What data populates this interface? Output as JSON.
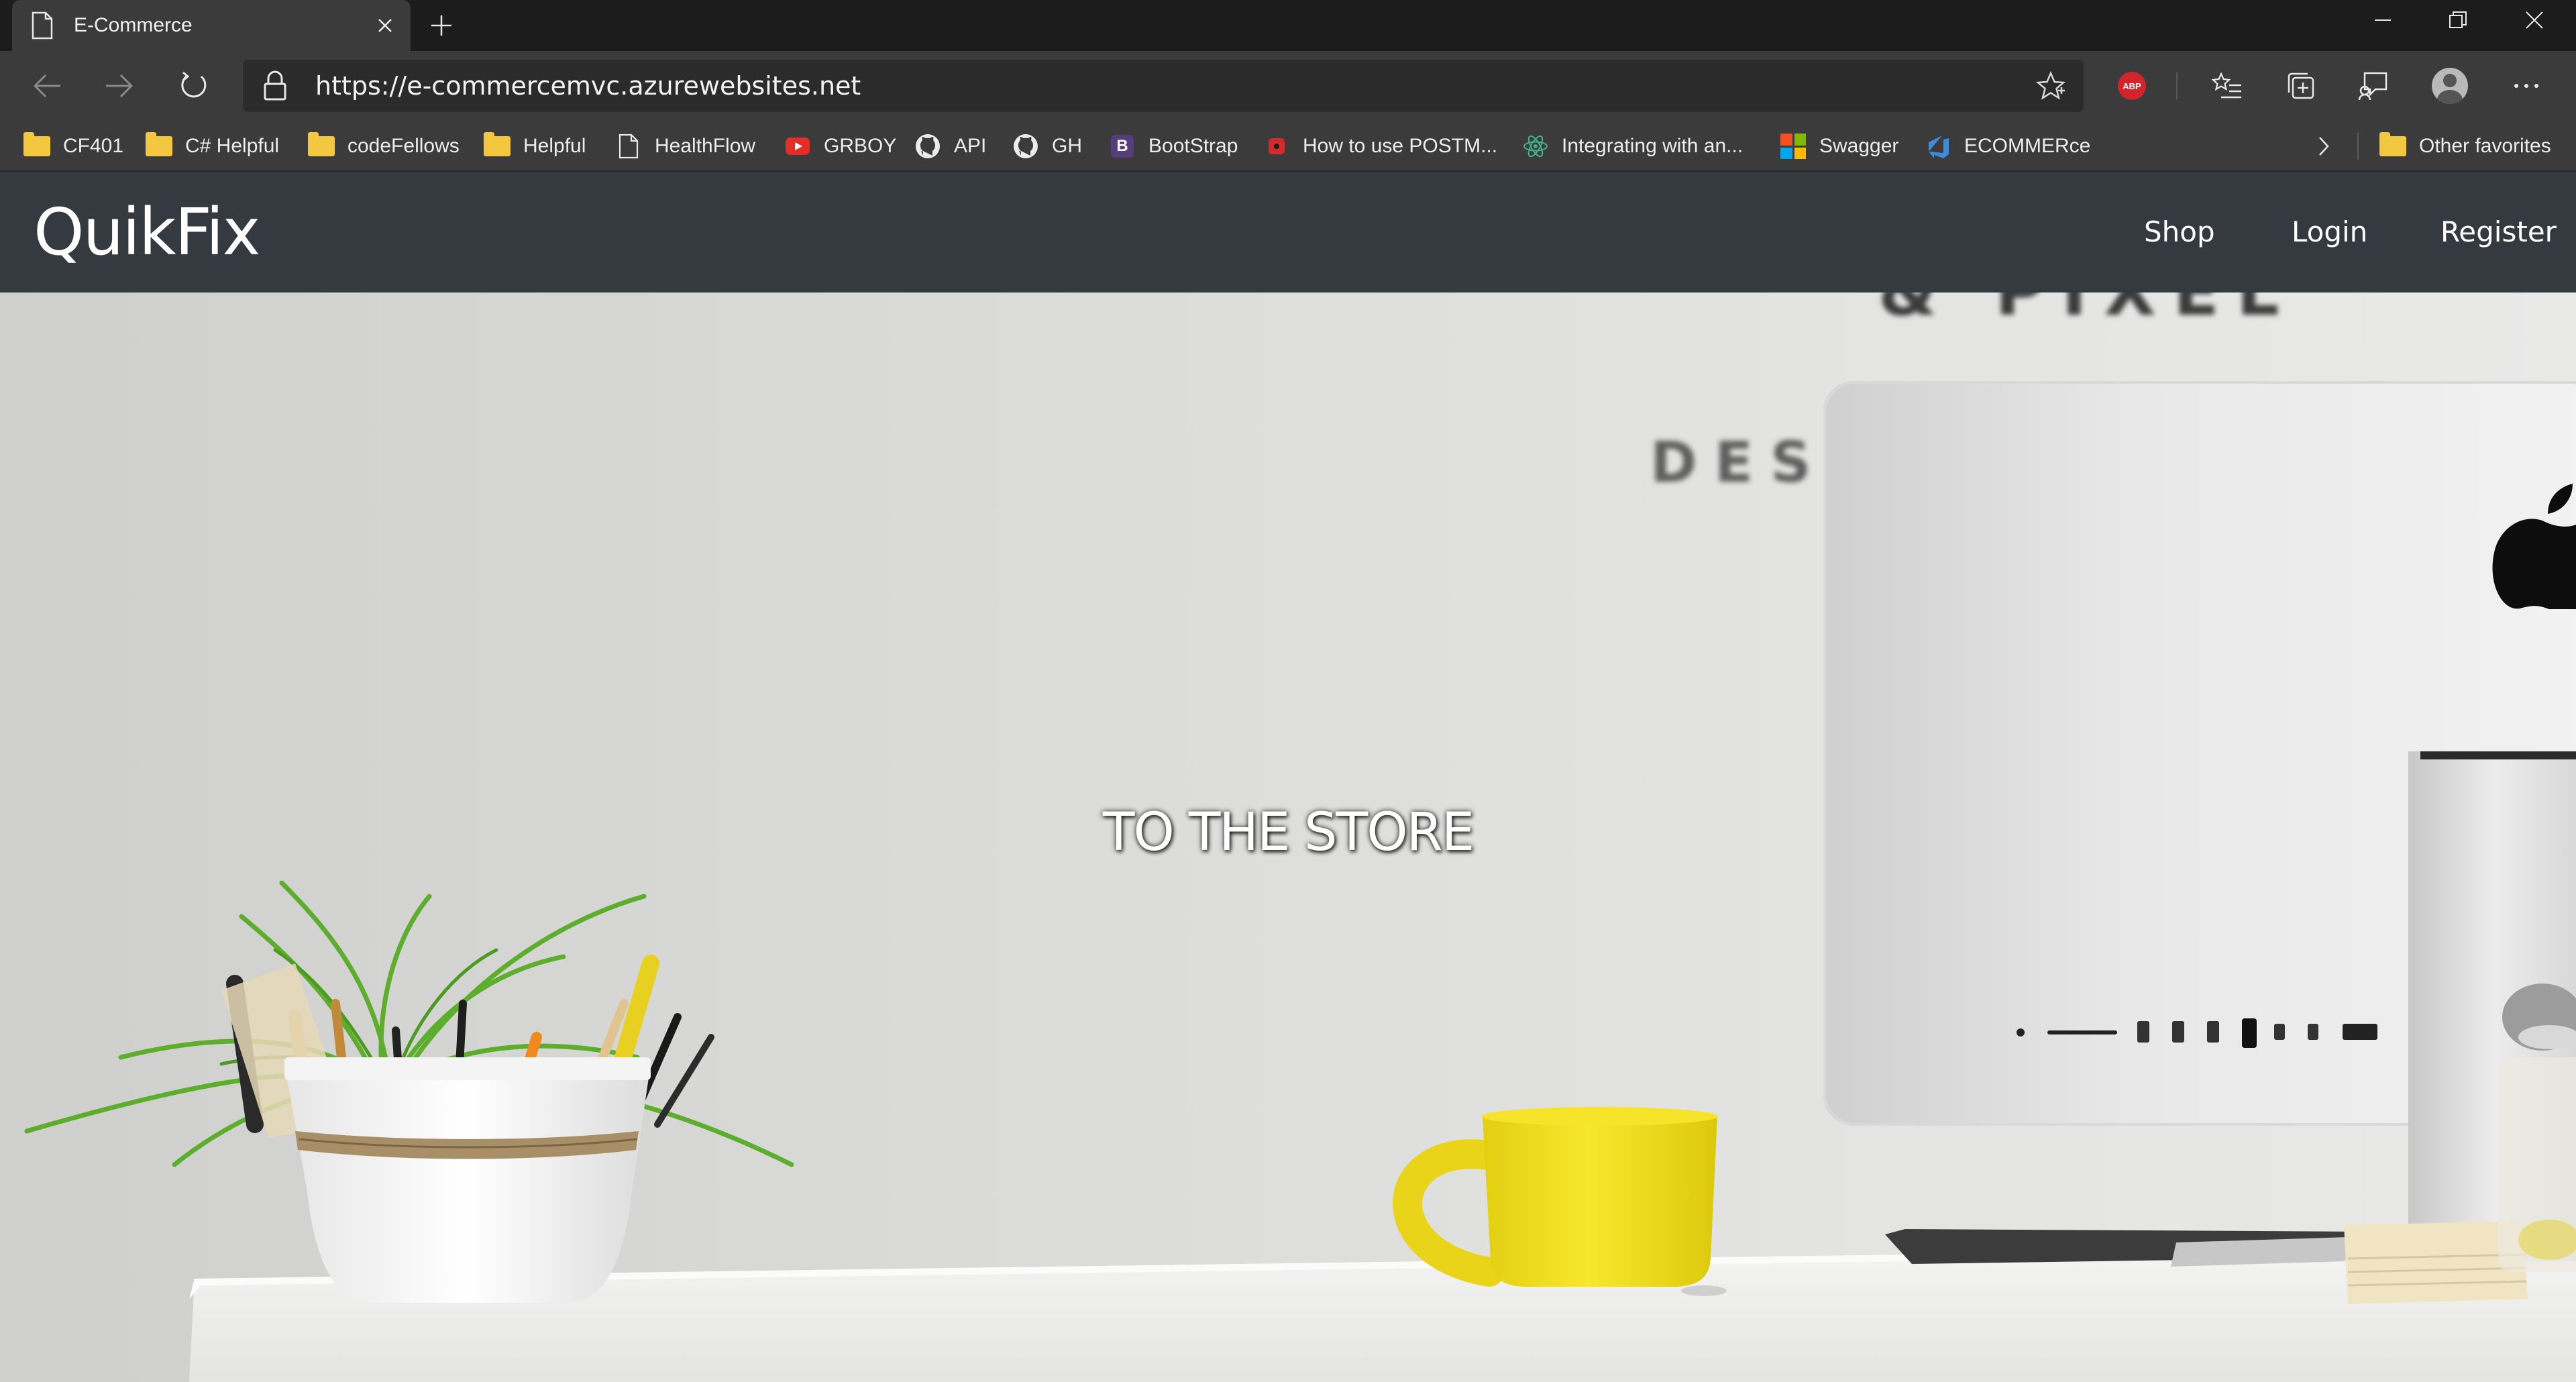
{
  "browser": {
    "tab_title": "E-Commerce",
    "url": "https://e-commercemvc.azurewebsites.net",
    "favorites": [
      {
        "label": "CF401",
        "icon": "folder-icon"
      },
      {
        "label": "C# Helpful",
        "icon": "folder-icon"
      },
      {
        "label": "codeFellows",
        "icon": "folder-icon"
      },
      {
        "label": "Helpful",
        "icon": "folder-icon"
      },
      {
        "label": "HealthFlow",
        "icon": "page-icon"
      },
      {
        "label": "GRBOY",
        "icon": "youtube-icon"
      },
      {
        "label": "API",
        "icon": "github-icon"
      },
      {
        "label": "GH",
        "icon": "github-icon"
      },
      {
        "label": "BootStrap",
        "icon": "bootstrap-icon"
      },
      {
        "label": "How to use POSTM...",
        "icon": "postman-icon"
      },
      {
        "label": "Integrating with an...",
        "icon": "react-icon"
      },
      {
        "label": "Swagger",
        "icon": "microsoft-icon"
      },
      {
        "label": "ECOMMERce",
        "icon": "azure-devops-icon"
      }
    ],
    "other_favorites": "Other favorites",
    "extension_badge": "ABP"
  },
  "site": {
    "brand": "QuikFix",
    "nav": {
      "shop": "Shop",
      "login": "Login",
      "register": "Register"
    },
    "hero_text": "TO THE STORE",
    "background_letters": {
      "desk_wall": "DES",
      "top_wall": "& PIXEL"
    }
  },
  "colors": {
    "navbar": "#343a40",
    "chrome_dark": "#1c1c1c",
    "chrome": "#3b3b3b",
    "cup_yellow": "#f2e11f",
    "plant_green": "#5cae2c"
  }
}
